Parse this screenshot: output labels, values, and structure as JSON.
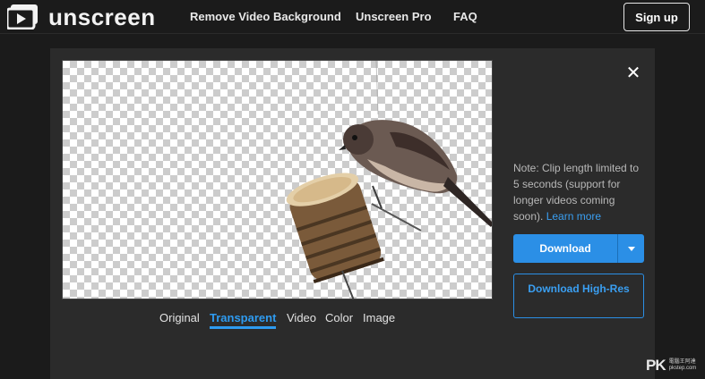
{
  "header": {
    "brand": "unscreen",
    "nav": [
      {
        "label": "Remove Video Background"
      },
      {
        "label": "Unscreen Pro"
      },
      {
        "label": "FAQ"
      }
    ],
    "signup_label": "Sign up"
  },
  "preview": {
    "tabs": [
      {
        "label": "Original",
        "active": false
      },
      {
        "label": "Transparent",
        "active": true
      },
      {
        "label": "Video",
        "active": false
      },
      {
        "label": "Color",
        "active": false
      },
      {
        "label": "Image",
        "active": false
      }
    ]
  },
  "side": {
    "close_icon": "close-icon",
    "note_text": "Note: Clip length limited to 5 seconds (support for longer videos coming soon).",
    "learn_more": "Learn more",
    "download_label": "Download",
    "download_hires_label": "Download High-Res"
  },
  "watermark": {
    "mark": "PK",
    "line1": "電腦王阿達",
    "line2": "pkstep.com"
  },
  "colors": {
    "background": "#1b1b1b",
    "panel": "#2b2b2b",
    "accent": "#2b8fe6",
    "link": "#3a9ff2"
  }
}
